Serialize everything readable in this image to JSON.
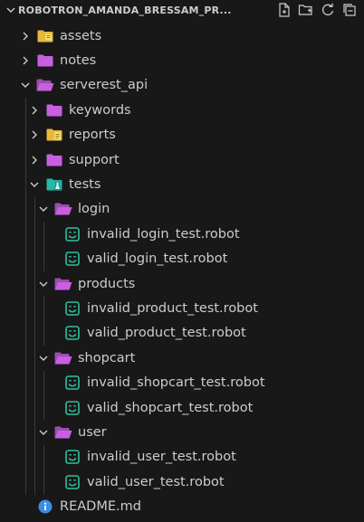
{
  "explorer": {
    "title": "ROBOTRON_AMANDA_BRESSAM_PR...",
    "actions": [
      {
        "name": "new-file-icon"
      },
      {
        "name": "new-folder-icon"
      },
      {
        "name": "refresh-icon"
      },
      {
        "name": "collapse-all-icon"
      }
    ]
  },
  "tree": [
    {
      "label": "assets",
      "depth": 1,
      "kind": "folder",
      "expanded": false,
      "icon": "assets-folder-icon",
      "color": "#e7b83b"
    },
    {
      "label": "notes",
      "depth": 1,
      "kind": "folder",
      "expanded": false,
      "icon": "folder-icon",
      "color": "#c75fe0"
    },
    {
      "label": "serverest_api",
      "depth": 1,
      "kind": "folder",
      "expanded": true,
      "icon": "folder-open-icon",
      "color": "#c75fe0"
    },
    {
      "label": "keywords",
      "depth": 2,
      "kind": "folder",
      "expanded": false,
      "icon": "folder-icon",
      "color": "#c75fe0"
    },
    {
      "label": "reports",
      "depth": 2,
      "kind": "folder",
      "expanded": false,
      "icon": "reports-folder-icon",
      "color": "#e7b83b"
    },
    {
      "label": "support",
      "depth": 2,
      "kind": "folder",
      "expanded": false,
      "icon": "folder-icon",
      "color": "#c75fe0"
    },
    {
      "label": "tests",
      "depth": 2,
      "kind": "folder",
      "expanded": true,
      "icon": "tests-folder-icon",
      "color": "#22b8a8"
    },
    {
      "label": "login",
      "depth": 3,
      "kind": "folder",
      "expanded": true,
      "icon": "folder-open-icon",
      "color": "#c75fe0"
    },
    {
      "label": "invalid_login_test.robot",
      "depth": 4,
      "kind": "file",
      "icon": "robot-file-icon",
      "color": "#2fbf9c"
    },
    {
      "label": "valid_login_test.robot",
      "depth": 4,
      "kind": "file",
      "icon": "robot-file-icon",
      "color": "#2fbf9c"
    },
    {
      "label": "products",
      "depth": 3,
      "kind": "folder",
      "expanded": true,
      "icon": "folder-open-icon",
      "color": "#c75fe0"
    },
    {
      "label": "invalid_product_test.robot",
      "depth": 4,
      "kind": "file",
      "icon": "robot-file-icon",
      "color": "#2fbf9c"
    },
    {
      "label": "valid_product_test.robot",
      "depth": 4,
      "kind": "file",
      "icon": "robot-file-icon",
      "color": "#2fbf9c"
    },
    {
      "label": "shopcart",
      "depth": 3,
      "kind": "folder",
      "expanded": true,
      "icon": "folder-open-icon",
      "color": "#c75fe0"
    },
    {
      "label": "invalid_shopcart_test.robot",
      "depth": 4,
      "kind": "file",
      "icon": "robot-file-icon",
      "color": "#2fbf9c"
    },
    {
      "label": "valid_shopcart_test.robot",
      "depth": 4,
      "kind": "file",
      "icon": "robot-file-icon",
      "color": "#2fbf9c"
    },
    {
      "label": "user",
      "depth": 3,
      "kind": "folder",
      "expanded": true,
      "icon": "folder-open-icon",
      "color": "#c75fe0"
    },
    {
      "label": "invalid_user_test.robot",
      "depth": 4,
      "kind": "file",
      "icon": "robot-file-icon",
      "color": "#2fbf9c"
    },
    {
      "label": "valid_user_test.robot",
      "depth": 4,
      "kind": "file",
      "icon": "robot-file-icon",
      "color": "#2fbf9c"
    },
    {
      "label": "README.md",
      "depth": 1,
      "kind": "file",
      "icon": "info-icon",
      "color": "#3a8ee6"
    }
  ]
}
